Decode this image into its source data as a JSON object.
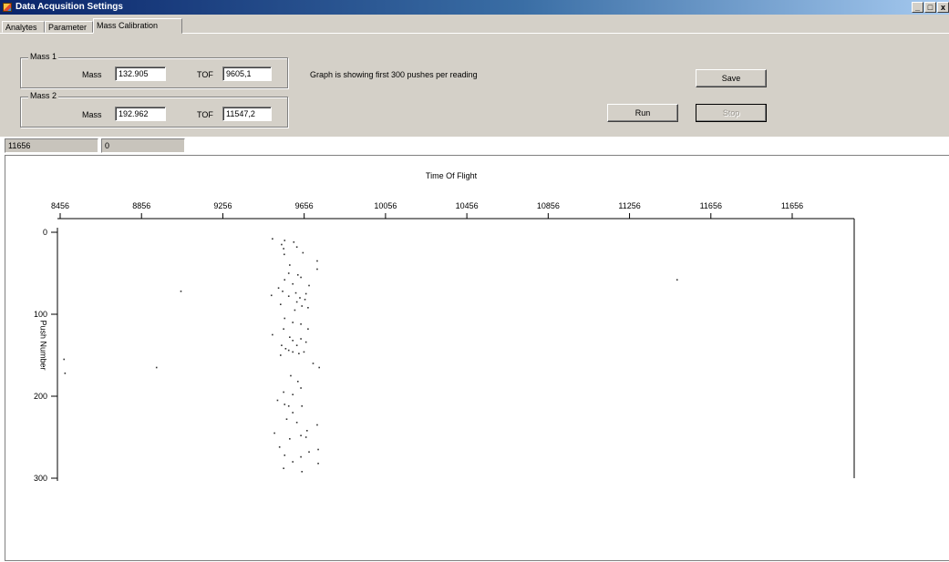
{
  "window": {
    "title": "Data Acqusition Settings",
    "controls": [
      "_",
      "□",
      "x"
    ]
  },
  "tabs": [
    {
      "label": "Analytes",
      "active": false
    },
    {
      "label": "Parameter",
      "active": false
    },
    {
      "label": "Mass Calibration",
      "active": true
    }
  ],
  "mass1": {
    "group_label": "Mass 1",
    "mass_label": "Mass",
    "mass_value": "132.905",
    "tof_label": "TOF",
    "tof_value": "9605,1"
  },
  "mass2": {
    "group_label": "Mass 2",
    "mass_label": "Mass",
    "mass_value": "192.962",
    "tof_label": "TOF",
    "tof_value": "11547,2"
  },
  "info_text": "Graph is showing first 300 pushes per reading",
  "buttons": {
    "save": "Save",
    "run": "Run",
    "stop": "Stop"
  },
  "readouts": {
    "left": "11656",
    "right": "0"
  },
  "chart_data": {
    "type": "scatter",
    "title": "Time Of Flight",
    "xlabel": "Time Of Flight",
    "ylabel": "Push Number",
    "x_axis_position": "top",
    "y_inverted": true,
    "xlim": [
      8456,
      12456
    ],
    "ylim": [
      0,
      300
    ],
    "x_tick_labels": [
      "8456",
      "8856",
      "9256",
      "9656",
      "10056",
      "10456",
      "10856",
      "11256",
      "11656",
      "11656"
    ],
    "x_tick_values": [
      8456,
      8856,
      9256,
      9656,
      10056,
      10456,
      10856,
      11256,
      11656,
      12056
    ],
    "y_ticks": [
      0,
      100,
      200,
      300
    ],
    "grid": false,
    "points": [
      [
        9500,
        8
      ],
      [
        9560,
        10
      ],
      [
        9605,
        12
      ],
      [
        9545,
        15
      ],
      [
        9555,
        20
      ],
      [
        9620,
        18
      ],
      [
        9650,
        25
      ],
      [
        9558,
        27
      ],
      [
        9720,
        35
      ],
      [
        9585,
        40
      ],
      [
        9720,
        45
      ],
      [
        9580,
        50
      ],
      [
        9625,
        52
      ],
      [
        9640,
        55
      ],
      [
        9560,
        58
      ],
      [
        9600,
        63
      ],
      [
        9680,
        65
      ],
      [
        9530,
        68
      ],
      [
        9550,
        72
      ],
      [
        9615,
        74
      ],
      [
        9665,
        75
      ],
      [
        9495,
        77
      ],
      [
        9580,
        78
      ],
      [
        9635,
        80
      ],
      [
        9660,
        82
      ],
      [
        9620,
        85
      ],
      [
        9540,
        88
      ],
      [
        9645,
        90
      ],
      [
        9675,
        92
      ],
      [
        9610,
        95
      ],
      [
        9560,
        105
      ],
      [
        9600,
        110
      ],
      [
        9640,
        112
      ],
      [
        9555,
        118
      ],
      [
        9675,
        118
      ],
      [
        9500,
        125
      ],
      [
        9585,
        128
      ],
      [
        9640,
        130
      ],
      [
        9600,
        132
      ],
      [
        9665,
        134
      ],
      [
        9545,
        138
      ],
      [
        9620,
        138
      ],
      [
        9565,
        142
      ],
      [
        9580,
        144
      ],
      [
        9600,
        146
      ],
      [
        9630,
        148
      ],
      [
        9655,
        146
      ],
      [
        9540,
        150
      ],
      [
        9700,
        160
      ],
      [
        9730,
        165
      ],
      [
        9590,
        175
      ],
      [
        9625,
        182
      ],
      [
        9640,
        190
      ],
      [
        9555,
        195
      ],
      [
        9600,
        198
      ],
      [
        9525,
        205
      ],
      [
        9560,
        210
      ],
      [
        9580,
        212
      ],
      [
        9645,
        212
      ],
      [
        9600,
        220
      ],
      [
        9570,
        228
      ],
      [
        9620,
        232
      ],
      [
        9720,
        235
      ],
      [
        9670,
        242
      ],
      [
        9510,
        245
      ],
      [
        9640,
        248
      ],
      [
        9665,
        250
      ],
      [
        9585,
        252
      ],
      [
        9535,
        262
      ],
      [
        9725,
        265
      ],
      [
        9680,
        268
      ],
      [
        9560,
        272
      ],
      [
        9640,
        274
      ],
      [
        9600,
        280
      ],
      [
        9725,
        282
      ],
      [
        9555,
        288
      ],
      [
        9645,
        292
      ],
      [
        9050,
        72
      ],
      [
        8930,
        165
      ],
      [
        8475,
        155
      ],
      [
        8480,
        172
      ],
      [
        11490,
        58
      ]
    ]
  }
}
